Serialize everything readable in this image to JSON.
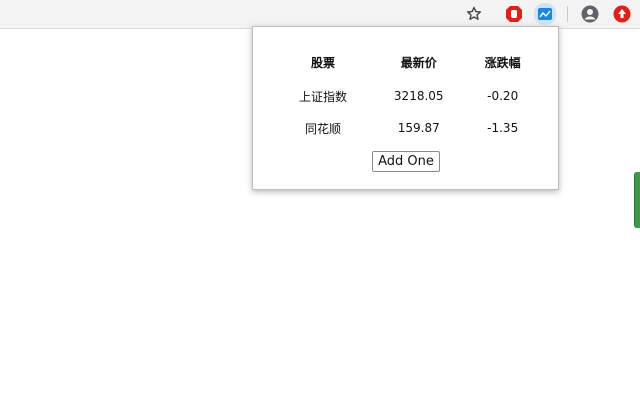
{
  "browser": {
    "icons": [
      "star-icon",
      "red-hand-extension-icon",
      "stock-extension-icon",
      "account-icon",
      "red-upload-extension-icon"
    ]
  },
  "popup": {
    "headers": [
      "股票",
      "最新价",
      "涨跌幅"
    ],
    "rows": [
      {
        "name": "上证指数",
        "price": "3218.05",
        "change": "-0.20"
      },
      {
        "name": "同花顺",
        "price": "159.87",
        "change": "-1.35"
      }
    ],
    "add_button": "Add One"
  },
  "colors": {
    "extension_red": "#e0201b",
    "extension_blue": "#1a88e0",
    "side_handle": "#3c9b4b"
  }
}
